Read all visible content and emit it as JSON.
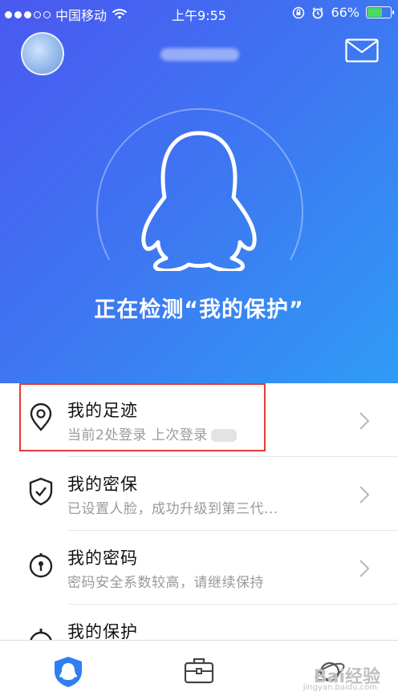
{
  "status_bar": {
    "carrier": "中国移动",
    "time": "上午9:55",
    "battery_percent": "66%",
    "battery_level": 0.66
  },
  "header": {
    "avatar_icon": "avatar",
    "mail_icon": "mail-icon"
  },
  "hero": {
    "status_text": "正在检测“我的保护”"
  },
  "list": [
    {
      "title": "我的足迹",
      "subtitle": "当前2处登录 上次登录",
      "icon": "location-pin-icon"
    },
    {
      "title": "我的密保",
      "subtitle": "已设置人脸，成功升级到第三代...",
      "icon": "shield-check-icon"
    },
    {
      "title": "我的密码",
      "subtitle": "密码安全系数较高，请继续保持",
      "icon": "lock-icon"
    },
    {
      "title": "我的保护",
      "icon": "protection-icon"
    }
  ],
  "tabbar": {
    "tabs": [
      {
        "icon": "shield-penguin-icon",
        "active": true
      },
      {
        "icon": "toolbox-icon",
        "active": false
      },
      {
        "icon": "planet-icon",
        "active": false
      }
    ]
  },
  "watermark": {
    "text": "Bai经验",
    "sub": "jingyan.baidu.com"
  },
  "colors": {
    "hero_start": "#4a58f0",
    "hero_end": "#2f9cf4",
    "highlight_border": "#e23c3c",
    "active_tab": "#2f7ff0"
  }
}
